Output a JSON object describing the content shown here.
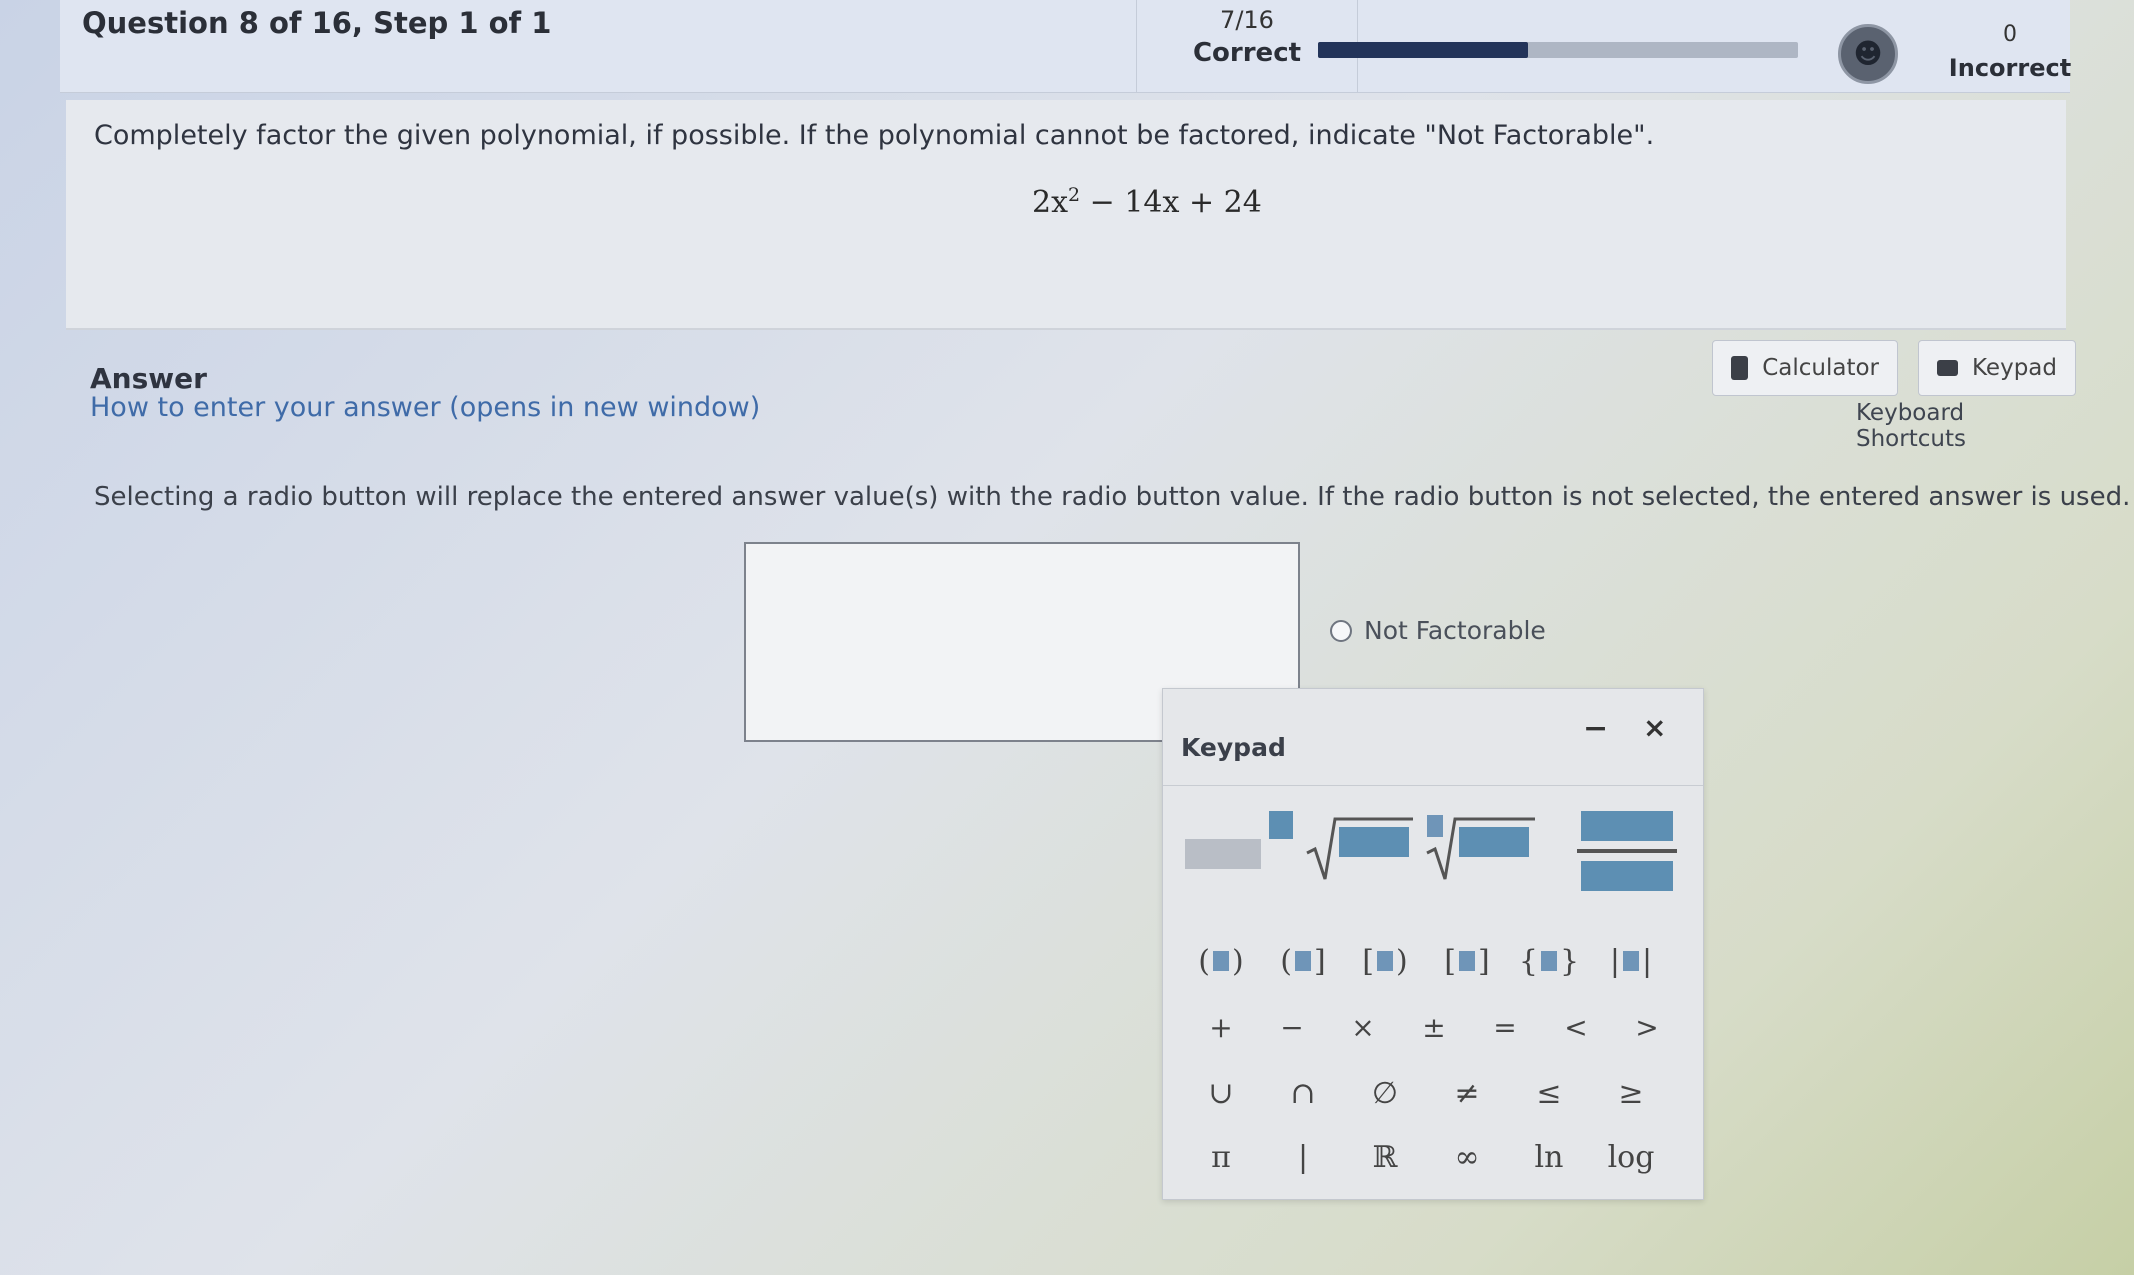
{
  "header": {
    "question_title": "Question 8 of 16,  Step 1 of 1",
    "correct_fraction": "7/16",
    "correct_label": "Correct",
    "progress_fraction": 0.4375,
    "incorrect_count": "0",
    "incorrect_label": "Incorrect"
  },
  "question": {
    "prompt": "Completely factor the given polynomial, if possible. If the polynomial cannot be factored, indicate \"Not Factorable\".",
    "expression": {
      "term1": "2x",
      "exp": "2",
      "rest": " − 14x + 24"
    }
  },
  "answer": {
    "heading": "Answer",
    "help_link": "How to enter your answer (opens in new window)",
    "calculator_label": "Calculator",
    "keypad_label": "Keypad",
    "shortcuts_label": "Keyboard Shortcuts",
    "radio_note": "Selecting a radio button will replace the entered answer value(s) with the radio button value. If the radio button is not selected, the entered answer is used.",
    "not_factorable_label": "Not Factorable"
  },
  "keypad": {
    "title": "Keypad",
    "minimize": "−",
    "close": "×",
    "bracket_keys": [
      {
        "open": "(",
        "close": ")"
      },
      {
        "open": "(",
        "close": "]"
      },
      {
        "open": "[",
        "close": ")"
      },
      {
        "open": "[",
        "close": "]"
      },
      {
        "open": "{",
        "close": "}"
      },
      {
        "open": "|",
        "close": "|"
      }
    ],
    "operator_keys": [
      "+",
      "−",
      "×",
      "±",
      "=",
      "<",
      ">"
    ],
    "set_keys": [
      "∪",
      "∩",
      "∅",
      "≠",
      "≤",
      "≥"
    ],
    "const_keys": [
      "π",
      "|",
      "ℝ",
      "∞",
      "ln",
      "log"
    ]
  }
}
